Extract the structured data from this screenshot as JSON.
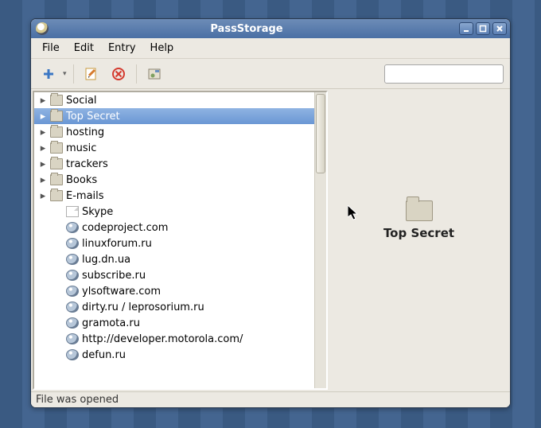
{
  "window": {
    "title": "PassStorage"
  },
  "menubar": {
    "items": [
      "File",
      "Edit",
      "Entry",
      "Help"
    ]
  },
  "toolbar": {
    "add_label": "Add",
    "edit_label": "Edit",
    "remove_label": "Remove",
    "settings_label": "Settings"
  },
  "search": {
    "placeholder": "",
    "value": ""
  },
  "tree": {
    "items": [
      {
        "type": "folder",
        "label": "Social",
        "expandable": true,
        "selected": false,
        "depth": 0
      },
      {
        "type": "folder",
        "label": "Top Secret",
        "expandable": true,
        "selected": true,
        "depth": 0
      },
      {
        "type": "folder",
        "label": "hosting",
        "expandable": true,
        "selected": false,
        "depth": 0
      },
      {
        "type": "folder",
        "label": "music",
        "expandable": true,
        "selected": false,
        "depth": 0
      },
      {
        "type": "folder",
        "label": "trackers",
        "expandable": true,
        "selected": false,
        "depth": 0
      },
      {
        "type": "folder",
        "label": "Books",
        "expandable": true,
        "selected": false,
        "depth": 0
      },
      {
        "type": "folder",
        "label": "E-mails",
        "expandable": true,
        "selected": false,
        "depth": 0
      },
      {
        "type": "note",
        "label": "Skype",
        "expandable": false,
        "selected": false,
        "depth": 1
      },
      {
        "type": "web",
        "label": "codeproject.com",
        "expandable": false,
        "selected": false,
        "depth": 1
      },
      {
        "type": "web",
        "label": "linuxforum.ru",
        "expandable": false,
        "selected": false,
        "depth": 1
      },
      {
        "type": "web",
        "label": "lug.dn.ua",
        "expandable": false,
        "selected": false,
        "depth": 1
      },
      {
        "type": "web",
        "label": "subscribe.ru",
        "expandable": false,
        "selected": false,
        "depth": 1
      },
      {
        "type": "web",
        "label": "ylsoftware.com",
        "expandable": false,
        "selected": false,
        "depth": 1
      },
      {
        "type": "web",
        "label": "dirty.ru / leprosorium.ru",
        "expandable": false,
        "selected": false,
        "depth": 1
      },
      {
        "type": "web",
        "label": "gramota.ru",
        "expandable": false,
        "selected": false,
        "depth": 1
      },
      {
        "type": "web",
        "label": "http://developer.motorola.com/",
        "expandable": false,
        "selected": false,
        "depth": 1
      },
      {
        "type": "web",
        "label": "defun.ru",
        "expandable": false,
        "selected": false,
        "depth": 1
      }
    ]
  },
  "detail": {
    "name": "Top Secret"
  },
  "statusbar": {
    "text": "File was opened"
  },
  "colors": {
    "selection": "#6a97d4",
    "window_bg": "#ece9e2",
    "titlebar": "#4a6fa4"
  }
}
